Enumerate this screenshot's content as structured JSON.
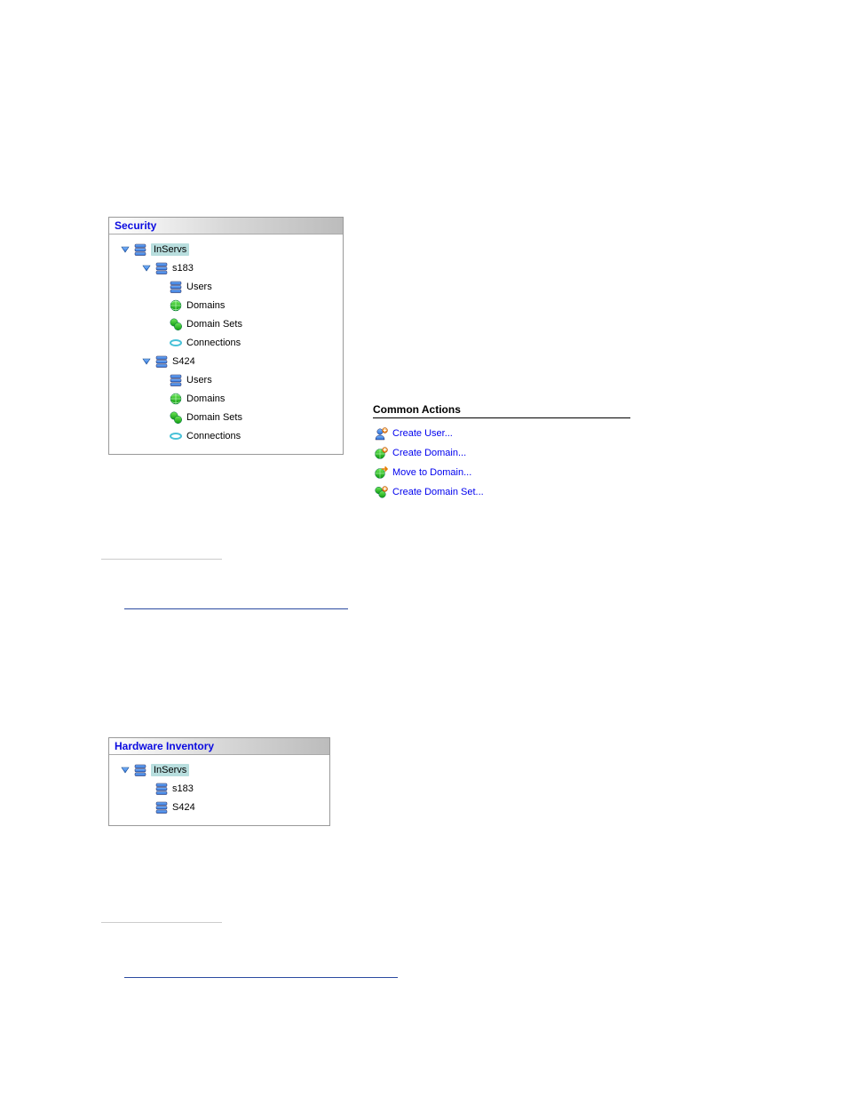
{
  "securityPanel": {
    "title": "Security",
    "root": "InServs",
    "servers": [
      {
        "name": "s183",
        "children": [
          {
            "label": "Users",
            "icon": "server-icon"
          },
          {
            "label": "Domains",
            "icon": "globe-icon"
          },
          {
            "label": "Domain Sets",
            "icon": "domainset-icon"
          },
          {
            "label": "Connections",
            "icon": "connection-icon"
          }
        ]
      },
      {
        "name": "S424",
        "children": [
          {
            "label": "Users",
            "icon": "server-icon"
          },
          {
            "label": "Domains",
            "icon": "globe-icon"
          },
          {
            "label": "Domain Sets",
            "icon": "domainset-icon"
          },
          {
            "label": "Connections",
            "icon": "connection-icon"
          }
        ]
      }
    ]
  },
  "commonActions": {
    "title": "Common Actions",
    "items": [
      {
        "label": "Create User...",
        "icon": "user-add-icon"
      },
      {
        "label": "Create Domain...",
        "icon": "globe-add-icon"
      },
      {
        "label": "Move to Domain...",
        "icon": "globe-move-icon"
      },
      {
        "label": "Create Domain Set...",
        "icon": "domainset-add-icon"
      }
    ]
  },
  "hardwarePanel": {
    "title": "Hardware Inventory",
    "root": "InServs",
    "servers": [
      {
        "name": "s183"
      },
      {
        "name": "S424"
      }
    ]
  }
}
